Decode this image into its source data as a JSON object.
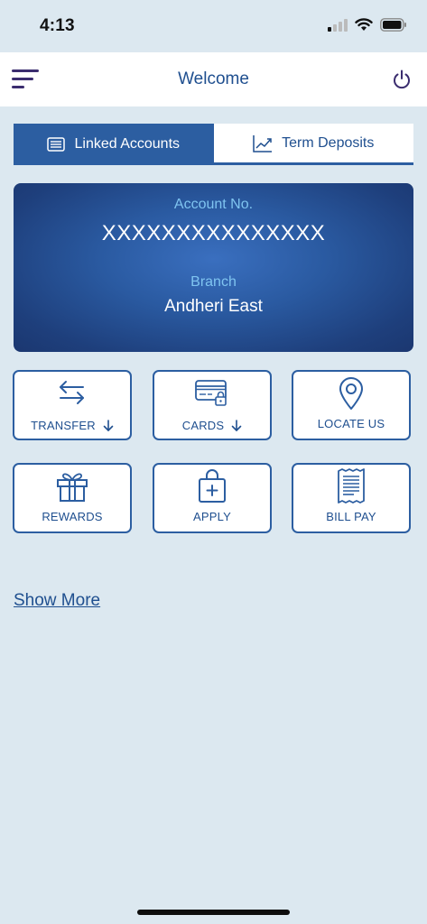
{
  "status_bar": {
    "time": "4:13"
  },
  "header": {
    "title": "Welcome"
  },
  "tabs": [
    {
      "label": "Linked Accounts",
      "active": true
    },
    {
      "label": "Term Deposits",
      "active": false
    }
  ],
  "account": {
    "account_label": "Account No.",
    "account_number": "XXXXXXXXXXXXXXX",
    "branch_label": "Branch",
    "branch_name": "Andheri East"
  },
  "actions": [
    {
      "label": "TRANSFER",
      "icon": "transfer-arrows-icon"
    },
    {
      "label": "CARDS",
      "icon": "credit-card-icon"
    },
    {
      "label": "LOCATE US",
      "icon": "map-pin-icon"
    },
    {
      "label": "REWARDS",
      "icon": "gift-icon"
    },
    {
      "label": "APPLY",
      "icon": "shopping-bag-plus-icon"
    },
    {
      "label": "BILL PAY",
      "icon": "receipt-icon"
    }
  ],
  "show_more": "Show More",
  "colors": {
    "accent": "#2c5ea1",
    "card_label": "#7fc4f0",
    "background": "#dce8f0"
  }
}
